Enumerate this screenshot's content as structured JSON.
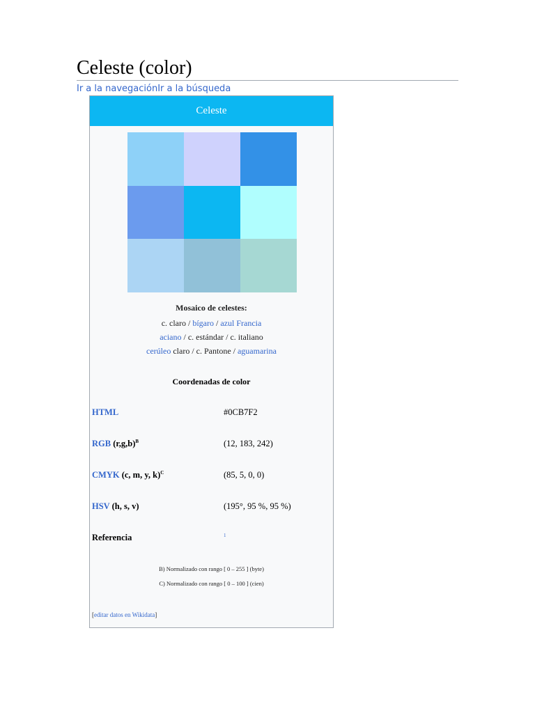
{
  "page": {
    "title": "Celeste (color)",
    "jump_nav": "Ir a la navegación",
    "jump_search": "Ir a la búsqueda"
  },
  "infobox": {
    "header": "Celeste",
    "mosaic_colors": [
      "#8ed1f8",
      "#cfd2fd",
      "#3391e7",
      "#6b9bee",
      "#0cb7f2",
      "#b0fefe",
      "#acd5f4",
      "#91c1d8",
      "#a6d8d3"
    ],
    "mosaic_title": "Mosaico de celestes:",
    "mosaic_line1": [
      {
        "text": "c. claro",
        "link": false
      },
      {
        "text": " / ",
        "link": false
      },
      {
        "text": "bígaro",
        "link": true
      },
      {
        "text": " / ",
        "link": false
      },
      {
        "text": "azul Francia",
        "link": true
      }
    ],
    "mosaic_line2": [
      {
        "text": "aciano",
        "link": true
      },
      {
        "text": " / c. estándar / c. italiano",
        "link": false
      }
    ],
    "mosaic_line3": [
      {
        "text": "cerúleo",
        "link": true
      },
      {
        "text": " claro / c. Pantone / ",
        "link": false
      },
      {
        "text": "aguamarina",
        "link": true
      }
    ],
    "coords_title": "Coordenadas de color",
    "rows": [
      {
        "label_link": "HTML",
        "label_rest": "",
        "sup": "",
        "value": "#0CB7F2"
      },
      {
        "label_link": "RGB",
        "label_rest": " (r,g,b)",
        "sup": "B",
        "value": "(12, 183, 242)"
      },
      {
        "label_link": "CMYK",
        "label_rest": " (c, m, y, k)",
        "sup": "C",
        "value": "(85, 5, 0, 0)"
      },
      {
        "label_link": "HSV",
        "label_rest": " (h, s, v)",
        "sup": "",
        "value": "(195°, 95 %, 95 %)"
      },
      {
        "label_link": "",
        "label_rest": "Referencia",
        "sup": "",
        "value": "1"
      }
    ],
    "note_b": "B) Normalizado con rango [ 0 – 255 ] (byte)",
    "note_c": "C) Normalizado con rango [ 0 – 100 ] (cien)",
    "wikidata_open": "[",
    "wikidata_link": "editar datos en Wikidata",
    "wikidata_close": "]"
  }
}
